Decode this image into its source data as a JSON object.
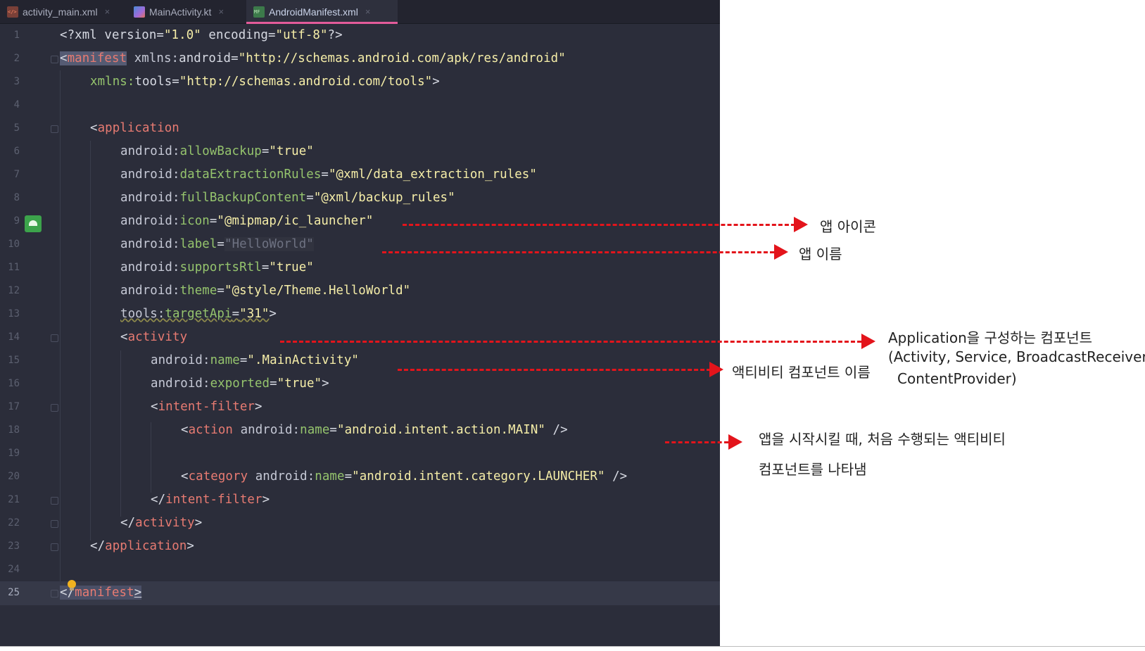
{
  "tabs": [
    {
      "label": "activity_main.xml",
      "close": "×"
    },
    {
      "label": "MainActivity.kt",
      "close": "×"
    },
    {
      "label": "AndroidManifest.xml",
      "close": "×"
    }
  ],
  "lines": {
    "n1": "1",
    "n2": "2",
    "n3": "3",
    "n4": "4",
    "n5": "5",
    "n6": "6",
    "n7": "7",
    "n8": "8",
    "n9": "9",
    "n10": "10",
    "n11": "11",
    "n12": "12",
    "n13": "13",
    "n14": "14",
    "n15": "15",
    "n16": "16",
    "n17": "17",
    "n18": "18",
    "n19": "19",
    "n20": "20",
    "n21": "21",
    "n22": "22",
    "n23": "23",
    "n24": "24",
    "n25": "25"
  },
  "code": {
    "l1": {
      "a": "<?xml version=",
      "b": "\"1.0\"",
      "c": " encoding=",
      "d": "\"utf-8\"",
      "e": "?>"
    },
    "l2": {
      "lt": "<",
      "tag": "manifest",
      "ns": " xmlns:",
      "attr": "android",
      "eq": "=",
      "val": "\"http://schemas.android.com/apk/res/android\""
    },
    "l3": {
      "ns": "xmlns:",
      "attr": "tools",
      "eq": "=",
      "val": "\"http://schemas.android.com/tools\"",
      "end": ">"
    },
    "l5": {
      "lt": "<",
      "tag": "application"
    },
    "l6": {
      "ns": "android:",
      "attr": "allowBackup",
      "eq": "=",
      "val": "\"true\""
    },
    "l7": {
      "ns": "android:",
      "attr": "dataExtractionRules",
      "eq": "=",
      "val": "\"@xml/data_extraction_rules\""
    },
    "l8": {
      "ns": "android:",
      "attr": "fullBackupContent",
      "eq": "=",
      "val": "\"@xml/backup_rules\""
    },
    "l9": {
      "ns": "android:",
      "attr": "icon",
      "eq": "=",
      "val": "\"@mipmap/ic_launcher\""
    },
    "l10": {
      "ns": "android:",
      "attr": "label",
      "eq": "=",
      "val": "\"HelloWorld\""
    },
    "l11": {
      "ns": "android:",
      "attr": "supportsRtl",
      "eq": "=",
      "val": "\"true\""
    },
    "l12": {
      "ns": "android:",
      "attr": "theme",
      "eq": "=",
      "val": "\"@style/Theme.HelloWorld\""
    },
    "l13": {
      "ns": "tools:",
      "attr": "targetApi",
      "eq": "=",
      "val": "\"31\"",
      "end": ">"
    },
    "l14": {
      "lt": "<",
      "tag": "activity"
    },
    "l15": {
      "ns": "android:",
      "attr": "name",
      "eq": "=",
      "val": "\".MainActivity\""
    },
    "l16": {
      "ns": "android:",
      "attr": "exported",
      "eq": "=",
      "val": "\"true\"",
      "end": ">"
    },
    "l17": {
      "lt": "<",
      "tag": "intent-filter",
      "end": ">"
    },
    "l18": {
      "lt": "<",
      "tag": "action",
      "ns": " android:",
      "attr": "name",
      "eq": "=",
      "val": "\"android.intent.action.MAIN\"",
      "end": " />"
    },
    "l20": {
      "lt": "<",
      "tag": "category",
      "ns": " android:",
      "attr": "name",
      "eq": "=",
      "val": "\"android.intent.category.LAUNCHER\"",
      "end": " />"
    },
    "l21": {
      "lt": "</",
      "tag": "intent-filter",
      "end": ">"
    },
    "l22": {
      "lt": "</",
      "tag": "activity",
      "end": ">"
    },
    "l23": {
      "lt": "</",
      "tag": "application",
      "end": ">"
    },
    "l25": {
      "lt": "</",
      "tag": "manifest",
      "end": ">"
    }
  },
  "annotations": {
    "icon": "앱 아이콘",
    "name": "앱 이름",
    "components_1": "Application을 구성하는 컴포넌트",
    "components_2": "(Activity, Service, BroadcastReceiver,",
    "components_3": "ContentProvider)",
    "activity_name": "액티비티 컴포넌트 이름",
    "launcher_1": "앱을 시작시킬 때, 처음 수행되는 액티비티",
    "launcher_2": "컴포넌트를 나타냄"
  },
  "colors": {
    "editor_bg": "#2b2d3a",
    "tag": "#e87b72",
    "attribute": "#95c46d",
    "string": "#f6eea8",
    "arrow": "#e3141b",
    "active_tab_underline": "#e35b9a"
  },
  "icons": [
    "xml-file-icon",
    "kotlin-file-icon",
    "manifest-file-icon",
    "android-gutter-icon",
    "lightbulb-icon",
    "fold-marker-icon"
  ]
}
